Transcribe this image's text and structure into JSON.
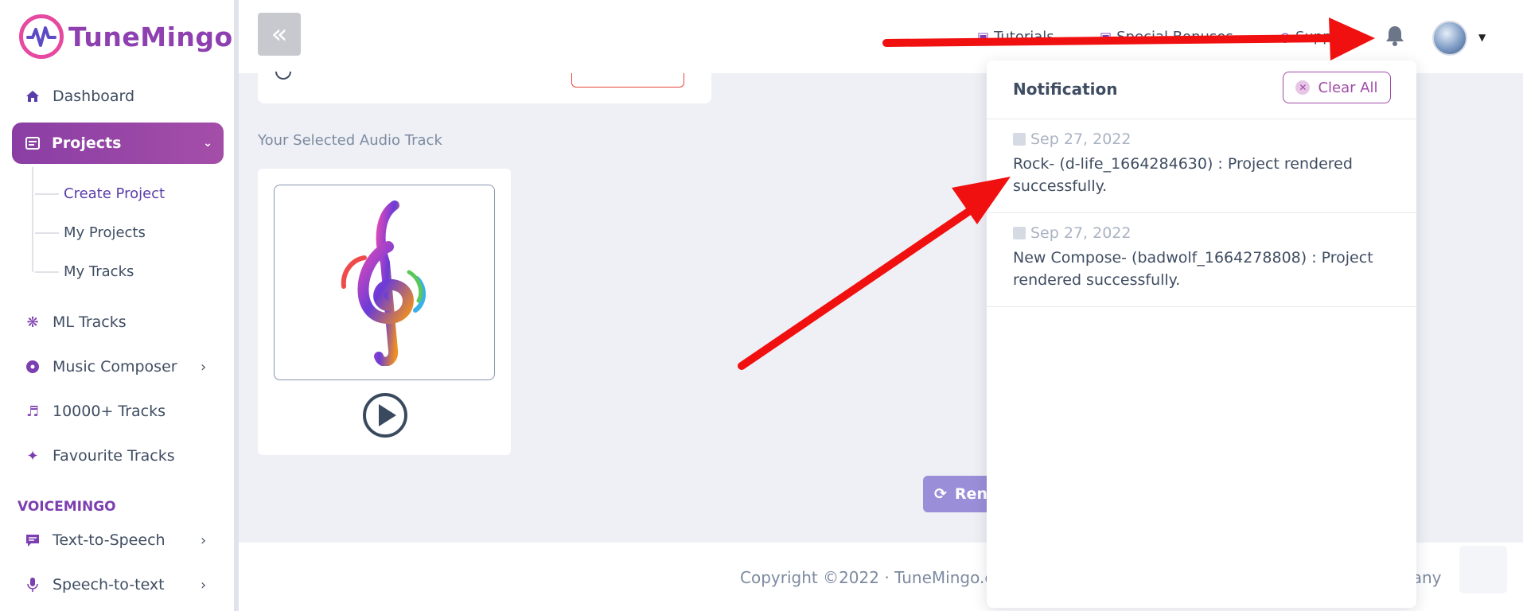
{
  "app": {
    "name": "TuneMingo"
  },
  "sidebar": {
    "items": [
      {
        "label": "Dashboard",
        "icon": "home-icon"
      },
      {
        "label": "Projects",
        "icon": "list-icon"
      },
      {
        "label": "ML Tracks",
        "icon": "atom-icon"
      },
      {
        "label": "Music Composer",
        "icon": "disc-icon"
      },
      {
        "label": "10000+ Tracks",
        "icon": "playlist-icon"
      },
      {
        "label": "Favourite Tracks",
        "icon": "star-icon"
      },
      {
        "label": "Text-to-Speech",
        "icon": "chat-icon"
      },
      {
        "label": "Speech-to-text",
        "icon": "microphone-icon"
      }
    ],
    "subitems": [
      {
        "label": "Create Project"
      },
      {
        "label": "My Projects"
      },
      {
        "label": "My Tracks"
      }
    ],
    "section_label": "VOICEMINGO"
  },
  "topbar": {
    "links": [
      {
        "label": "Tutorials"
      },
      {
        "label": "Special Bonuses"
      },
      {
        "label": "Supp"
      }
    ]
  },
  "main": {
    "audio_label": "Your Selected Audio Track",
    "render_label": "Ren"
  },
  "footer": {
    "left": "Copyright ©2022 · TuneMingo.c",
    "right": "pany"
  },
  "notifications": {
    "title": "Notification",
    "clear_label": "Clear All",
    "items": [
      {
        "date": "Sep 27, 2022",
        "message": "Rock- (d-life_1664284630) : Project rendered successfully."
      },
      {
        "date": "Sep 27, 2022",
        "message": "New Compose- (badwolf_1664278808) : Project rendered successfully."
      }
    ]
  },
  "colors": {
    "brand": "#8e3fb0",
    "accent_pink": "#e64aa0",
    "arrow": "#f01010"
  }
}
